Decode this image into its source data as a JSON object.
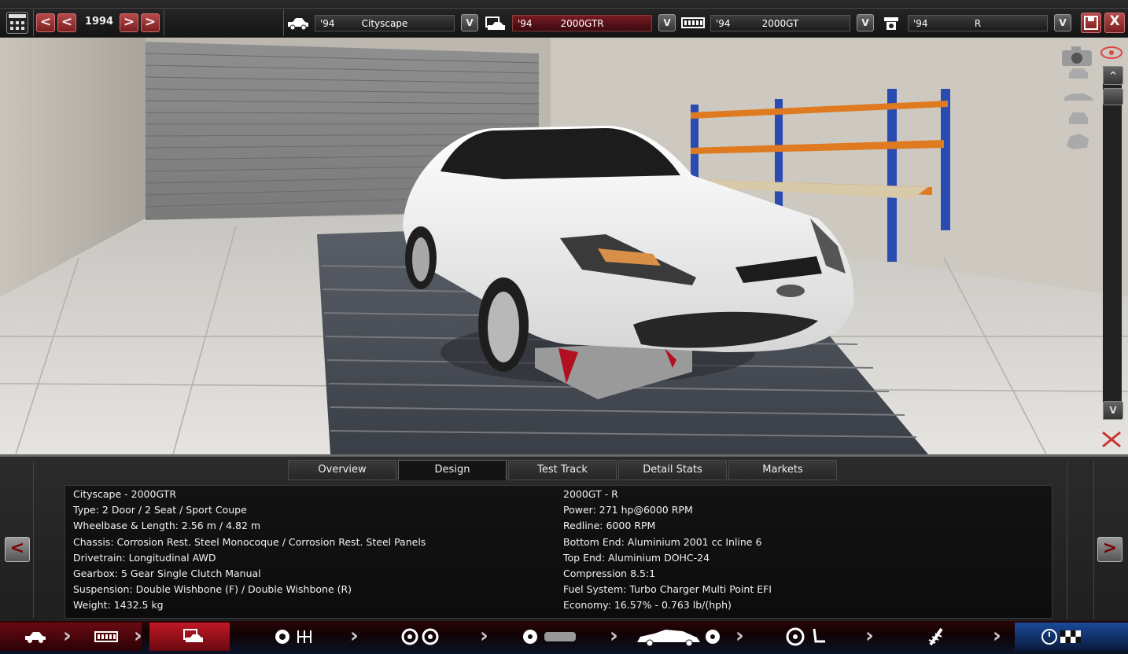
{
  "topbar": {
    "year": "1994",
    "prev_label": "<",
    "next_label": ">",
    "model": {
      "year": "'94",
      "name": "Cityscape"
    },
    "trim": {
      "year": "'94",
      "name": "2000GTR"
    },
    "engine_family": {
      "year": "'94",
      "name": "2000GT"
    },
    "engine_variant": {
      "year": "'94",
      "name": "R"
    },
    "dropdown_label": "V",
    "close_label": "X"
  },
  "viewport": {
    "scroll_up": "^",
    "scroll_down": "V"
  },
  "tabs": [
    {
      "label": "Overview"
    },
    {
      "label": "Design"
    },
    {
      "label": "Test Track"
    },
    {
      "label": "Detail Stats"
    },
    {
      "label": "Markets"
    }
  ],
  "active_tab": "Design",
  "car_stats": [
    "Cityscape - 2000GTR",
    "Type: 2 Door / 2 Seat / Sport Coupe",
    "Wheelbase & Length: 2.56 m / 4.82 m",
    "Chassis: Corrosion Rest. Steel Monocoque / Corrosion Rest. Steel Panels",
    "Drivetrain: Longitudinal AWD",
    "Gearbox: 5 Gear Single Clutch Manual",
    "Suspension: Double Wishbone (F) / Double Wishbone (R)",
    "Weight: 1432.5 kg"
  ],
  "engine_stats": [
    "2000GT - R",
    "Power: 271 hp@6000 RPM",
    "Redline: 6000 RPM",
    "Bottom End: Aluminium 2001 cc Inline 6",
    "Top End: Aluminium DOHC-24",
    "Compression 8.5:1",
    "Fuel System: Turbo Charger Multi Point EFI",
    "Economy: 16.57% - 0.763 lb/(hph)"
  ],
  "nav": {
    "prev": "<",
    "next": ">"
  },
  "colors": {
    "accent_red": "#8a0f16",
    "accent_blue": "#0a2a5a"
  }
}
